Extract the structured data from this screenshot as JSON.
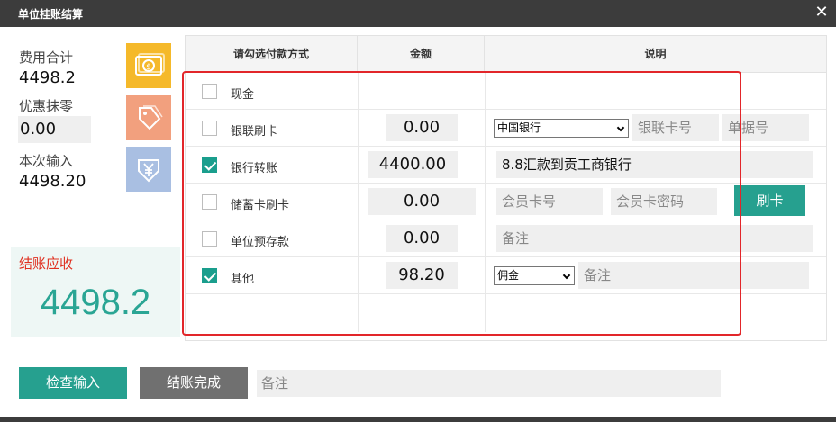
{
  "window": {
    "title": "单位挂账结算"
  },
  "summary": {
    "total_label": "费用合计",
    "total_value": "4498.2",
    "discount_label": "优惠抹零",
    "discount_value": "0.00",
    "input_label": "本次输入",
    "input_value": "4498.20",
    "due_label": "结账应收",
    "due_value": "4498.2"
  },
  "icons": [
    "money-icon",
    "tag-icon",
    "yuan-download-icon"
  ],
  "colors": {
    "accent": "#26a08f",
    "due_text": "#2aa594",
    "due_label": "#e03020",
    "highlight_frame": "#e2262a",
    "icon_money": "#f5b92a",
    "icon_tag": "#f2a07e",
    "icon_yuan": "#a9bfe2"
  },
  "table": {
    "headers": [
      "请勾选付款方式",
      "金额",
      "说明"
    ],
    "rows": [
      {
        "checked": false,
        "method": "现金"
      },
      {
        "checked": false,
        "method": "银联刷卡",
        "amount": "0.00",
        "bank": "中国银行",
        "card_no_placeholder": "银联卡号",
        "receipt_placeholder": "单据号"
      },
      {
        "checked": true,
        "method": "银行转账",
        "amount": "4400.00",
        "note": "8.8汇款到贡工商银行"
      },
      {
        "checked": false,
        "method": "储蓄卡刷卡",
        "amount": "0.00",
        "member_card_placeholder": "会员卡号",
        "member_pwd_placeholder": "会员卡密码",
        "swipe_label": "刷卡"
      },
      {
        "checked": false,
        "method": "单位预存款",
        "amount": "0.00",
        "note_placeholder": "备注"
      },
      {
        "checked": true,
        "method": "其他",
        "amount": "98.20",
        "type": "佣金",
        "note_placeholder": "备注"
      }
    ]
  },
  "actions": {
    "check_label": "检查输入",
    "finish_label": "结账完成",
    "note_placeholder": "备注"
  }
}
